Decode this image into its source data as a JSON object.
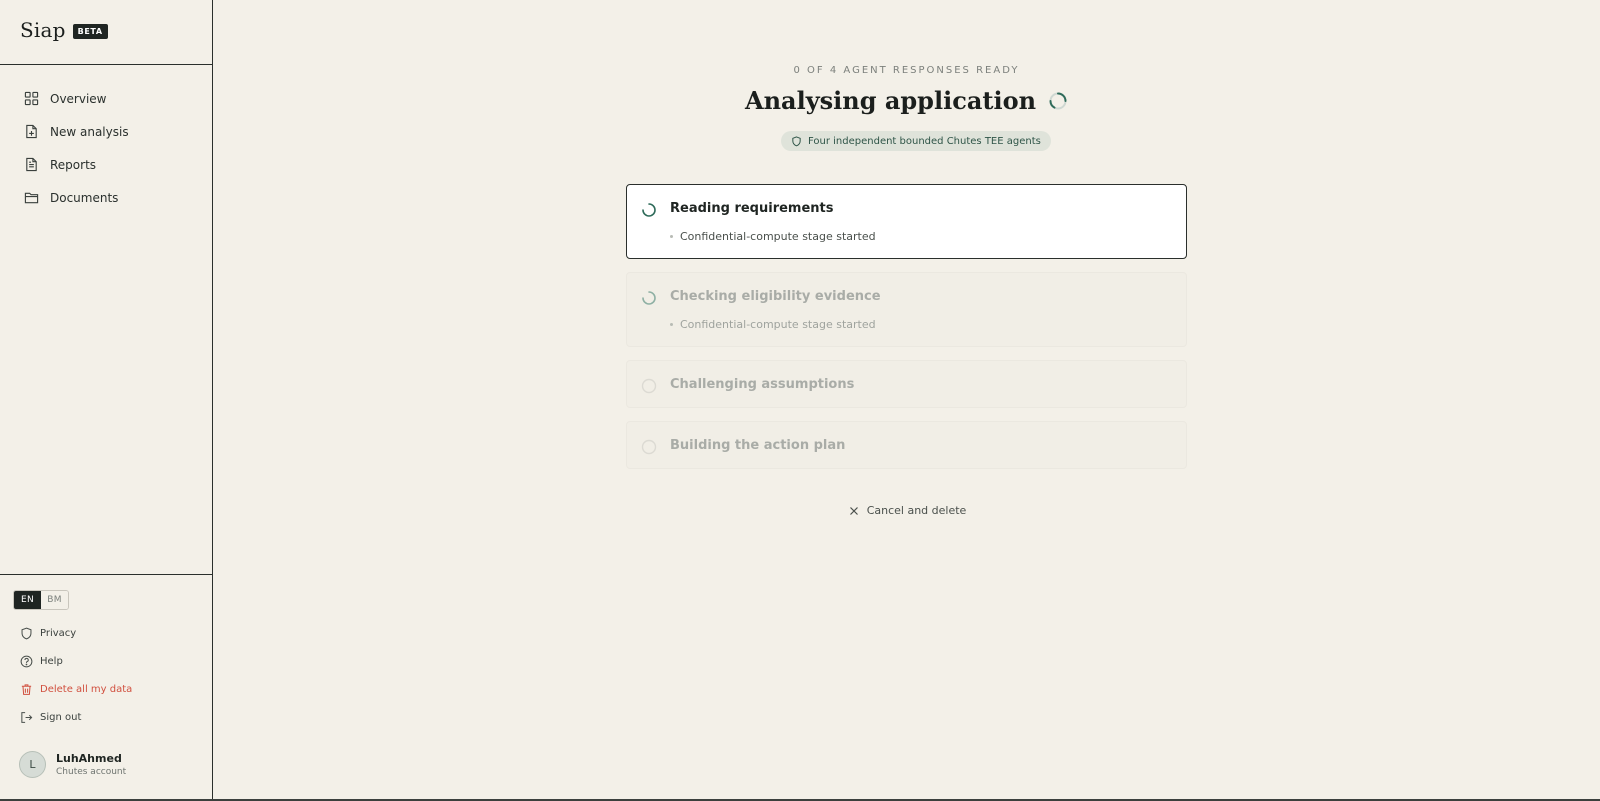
{
  "brand": {
    "name": "Siap",
    "badge": "BETA"
  },
  "nav": {
    "items": [
      {
        "label": "Overview",
        "icon": "grid-icon"
      },
      {
        "label": "New analysis",
        "icon": "file-plus-icon"
      },
      {
        "label": "Reports",
        "icon": "file-text-icon"
      },
      {
        "label": "Documents",
        "icon": "folder-icon"
      }
    ]
  },
  "language": {
    "options": [
      "EN",
      "BM"
    ],
    "selected": "EN"
  },
  "utility": {
    "privacy": "Privacy",
    "help": "Help",
    "delete_data": "Delete all my data",
    "sign_out": "Sign out"
  },
  "account": {
    "initial": "L",
    "name": "LuhAhmed",
    "subtitle": "Chutes account"
  },
  "main": {
    "progress_label": "0 OF 4 AGENT RESPONSES READY",
    "title": "Analysing application",
    "agents_pill": "Four independent bounded Chutes TEE agents",
    "steps": [
      {
        "title": "Reading requirements",
        "detail": "Confidential-compute stage started",
        "state": "active"
      },
      {
        "title": "Checking eligibility evidence",
        "detail": "Confidential-compute stage started",
        "state": "running"
      },
      {
        "title": "Challenging assumptions",
        "state": "pending"
      },
      {
        "title": "Building the action plan",
        "state": "pending"
      }
    ],
    "cancel_label": "Cancel and delete"
  },
  "colors": {
    "background": "#f3f0e8",
    "accent": "#2f6b5a",
    "danger": "#d1503f",
    "pill_bg": "#dfe3da"
  }
}
